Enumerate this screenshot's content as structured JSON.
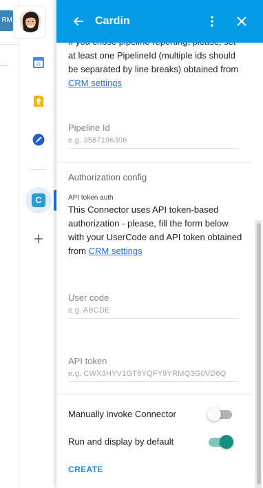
{
  "app": {
    "crm_button_label": "RM",
    "header_title": "Cardin"
  },
  "icons": {
    "back": "arrow-left-icon",
    "more": "more-vert-icon",
    "close": "close-icon",
    "calendar": "google-calendar-icon",
    "keep": "google-keep-icon",
    "tasks": "google-tasks-icon",
    "addon": "cardin-addon-icon",
    "add": "plus-icon"
  },
  "addon_badge_letter": "C",
  "calendar_day": "31",
  "pipeline": {
    "intro_text": "If you chose pipeline reporting, please, set at least one PipelineId (multiple ids should be separated by line breaks) obtained from",
    "link_text": "CRM settings",
    "field_label": "Pipeline Id",
    "placeholder": "e.g. 3587196306",
    "value": ""
  },
  "auth": {
    "section_title": "Authorization config",
    "small_label": "API token auth",
    "description": "This Connector uses API token-based authorization - please, fill the form below with your UserCode and API token obtained from",
    "link_text": "CRM settings",
    "user_code": {
      "label": "User code",
      "placeholder": "e.g. ABCDE",
      "value": ""
    },
    "api_token": {
      "label": "API token",
      "placeholder": "e.g. CWX3HYV1GT6YQFY9YRMQ3G0VD6Q",
      "value": ""
    }
  },
  "options": {
    "manual_invoke": {
      "label": "Manually invoke Connector",
      "enabled": false
    },
    "run_default": {
      "label": "Run and display by default",
      "enabled": true
    }
  },
  "create_label": "CREATE",
  "colors": {
    "header": "#039be5",
    "link": "#1a73e8",
    "toggle_on": "#14917e",
    "create": "#1a8fd8"
  }
}
